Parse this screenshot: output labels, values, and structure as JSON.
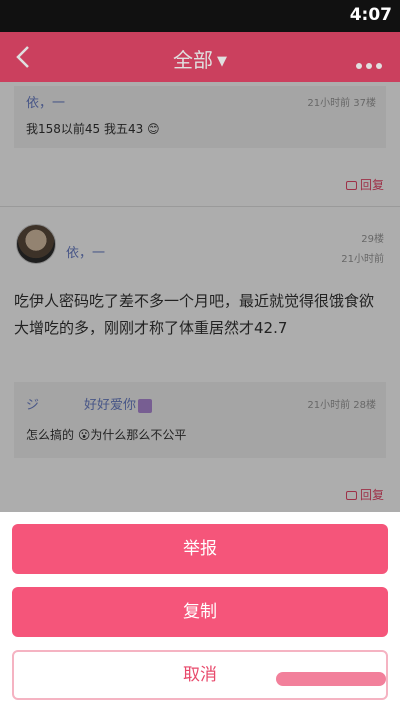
{
  "status_bar": {
    "time": "4:07"
  },
  "header": {
    "title": "全部",
    "dropdown_icon": "caret-down-icon",
    "back_icon": "chevron-left-icon",
    "more_icon": "more-dots-icon"
  },
  "top_reply": {
    "author": "依，一",
    "meta": "21小时前 37楼",
    "text": "我158以前45 我五43 😊",
    "reply_label": "回复"
  },
  "post": {
    "author": "依，一",
    "floor": "29楼",
    "time": "21小时前",
    "body": "吃伊人密码吃了差不多一个月吧，最近就觉得很饿食欲大增吃的多，刚刚才称了体重居然才42.7",
    "reply_label": "回复"
  },
  "quoted_reply": {
    "prefix": "ジ",
    "author": "好好爱你",
    "meta": "21小时前 28楼",
    "text": "怎么搞的 😮为什么那么不公平"
  },
  "action_sheet": {
    "report_label": "举报",
    "copy_label": "复制",
    "cancel_label": "取消"
  },
  "colors": {
    "accent": "#e8496b",
    "button": "#f5557a",
    "link": "#6a7fc7"
  }
}
